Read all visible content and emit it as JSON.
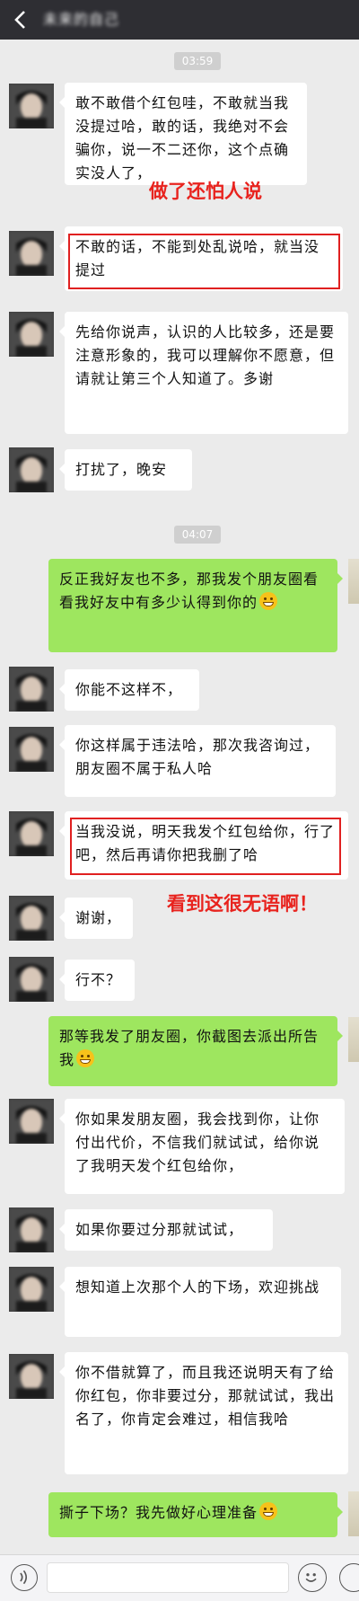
{
  "header": {
    "title": "未来的自己",
    "back_label": "<"
  },
  "timestamps": [
    "03:59",
    "04:07"
  ],
  "messages": [
    {
      "side": "left",
      "text": "敢不敢借个红包哇，不敢就当我没提过哈，敢的话，我绝对不会骗你，说一不二还你，这个点确实没人了，"
    },
    {
      "side": "left",
      "text": "不敢的话，不能到处乱说哈，就当没提过"
    },
    {
      "side": "left",
      "text": "先给你说声，认识的人比较多，还是要注意形象的，我可以理解你不愿意，但请就让第三个人知道了。多谢"
    },
    {
      "side": "left",
      "text": "打扰了，晚安"
    },
    {
      "side": "right",
      "text": "反正我好友也不多，那我发个朋友圈看看我好友中有多少认得到你的"
    },
    {
      "side": "left",
      "text": "你能不这样不，"
    },
    {
      "side": "left",
      "text": "你这样属于违法哈，那次我咨询过，朋友圈不属于私人哈"
    },
    {
      "side": "left",
      "text": "当我没说，明天我发个红包给你，行了吧，然后再请你把我删了哈"
    },
    {
      "side": "left",
      "text": "谢谢，"
    },
    {
      "side": "left",
      "text": "行不？"
    },
    {
      "side": "right",
      "text": "那等我发了朋友圈，你截图去派出所告我"
    },
    {
      "side": "left",
      "text": "你如果发朋友圈，我会找到你，让你付出代价，不信我们就试试，给你说了我明天发个红包给你，"
    },
    {
      "side": "left",
      "text": "如果你要过分那就试试，"
    },
    {
      "side": "left",
      "text": "想知道上次那个人的下场，欢迎挑战"
    },
    {
      "side": "left",
      "text": "你不借就算了，而且我还说明天有了给你红包，你非要过分，那就试试，我出名了，你肯定会难过，相信我哈"
    },
    {
      "side": "right",
      "text": "撕子下场？我先做好心理准备"
    }
  ],
  "annotations": [
    "做了还怕人说",
    "看到这很无语啊！"
  ],
  "colors": {
    "annotation": "#e8231e",
    "right_bubble": "#9ee65f",
    "topbar": "#2e2e33"
  },
  "icons": [
    "back-arrow-icon",
    "voice-icon",
    "emoji-icon",
    "plus-icon",
    "grin-emoji-icon"
  ]
}
